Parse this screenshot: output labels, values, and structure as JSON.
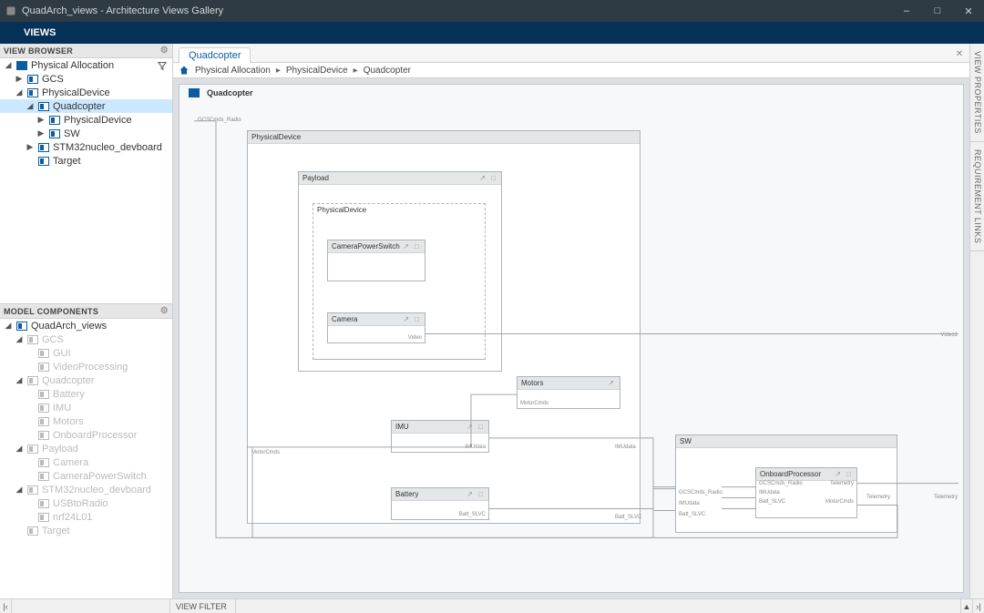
{
  "title": "QuadArch_views - Architecture Views Gallery",
  "menu": {
    "views": "VIEWS"
  },
  "panels": {
    "view_browser": "VIEW BROWSER",
    "model_components": "MODEL COMPONENTS",
    "view_filter": "VIEW FILTER",
    "view_properties": "VIEW PROPERTIES",
    "requirement_links": "REQUIREMENT LINKS"
  },
  "tree_top": [
    {
      "l": 0,
      "tw": "◢",
      "label": "Physical Allocation",
      "solid": true,
      "filter": true
    },
    {
      "l": 1,
      "tw": "▶",
      "label": "GCS"
    },
    {
      "l": 1,
      "tw": "◢",
      "label": "PhysicalDevice"
    },
    {
      "l": 2,
      "tw": "◢",
      "label": "Quadcopter",
      "sel": true
    },
    {
      "l": 3,
      "tw": "▶",
      "label": "PhysicalDevice"
    },
    {
      "l": 3,
      "tw": "▶",
      "label": "SW"
    },
    {
      "l": 2,
      "tw": "▶",
      "label": "STM32nucleo_devboard"
    },
    {
      "l": 2,
      "tw": "",
      "label": "Target"
    }
  ],
  "tree_bottom": [
    {
      "l": 0,
      "tw": "◢",
      "label": "QuadArch_views"
    },
    {
      "l": 1,
      "tw": "◢",
      "label": "GCS",
      "muted": true
    },
    {
      "l": 2,
      "tw": "",
      "label": "GUI",
      "muted": true
    },
    {
      "l": 2,
      "tw": "",
      "label": "VideoProcessing",
      "muted": true
    },
    {
      "l": 1,
      "tw": "◢",
      "label": "Quadcopter",
      "muted": true
    },
    {
      "l": 2,
      "tw": "",
      "label": "Battery",
      "muted": true
    },
    {
      "l": 2,
      "tw": "",
      "label": "IMU",
      "muted": true
    },
    {
      "l": 2,
      "tw": "",
      "label": "Motors",
      "muted": true
    },
    {
      "l": 2,
      "tw": "",
      "label": "OnboardProcessor",
      "muted": true
    },
    {
      "l": 1,
      "tw": "◢",
      "label": "Payload",
      "muted": true
    },
    {
      "l": 2,
      "tw": "",
      "label": "Camera",
      "muted": true
    },
    {
      "l": 2,
      "tw": "",
      "label": "CameraPowerSwitch",
      "muted": true
    },
    {
      "l": 1,
      "tw": "◢",
      "label": "STM32nucleo_devboard",
      "muted": true
    },
    {
      "l": 2,
      "tw": "",
      "label": "USBtoRadio",
      "muted": true
    },
    {
      "l": 2,
      "tw": "",
      "label": "nrf24L01",
      "muted": true
    },
    {
      "l": 1,
      "tw": "",
      "label": "Target",
      "muted": true
    }
  ],
  "doc_tab": "Quadcopter",
  "breadcrumb": {
    "a": "Physical Allocation",
    "b": "PhysicalDevice",
    "c": "Quadcopter"
  },
  "diagram": {
    "root": "Quadcopter",
    "pd": "PhysicalDevice",
    "payload": "Payload",
    "payload_inner": "PhysicalDevice",
    "cps": "CameraPowerSwitch",
    "camera": "Camera",
    "motors": "Motors",
    "imu": "IMU",
    "battery": "Battery",
    "sw": "SW",
    "op": "OnboardProcessor",
    "ports": {
      "gcs_radio": "GCSCmds_Radio",
      "motorcmds": "MotorCmds",
      "video": "Video",
      "imudata": "IMUdata",
      "batt_slvc": "Batt_SLVC",
      "telemetry": "Telemetry",
      "video1": "Video1"
    }
  }
}
